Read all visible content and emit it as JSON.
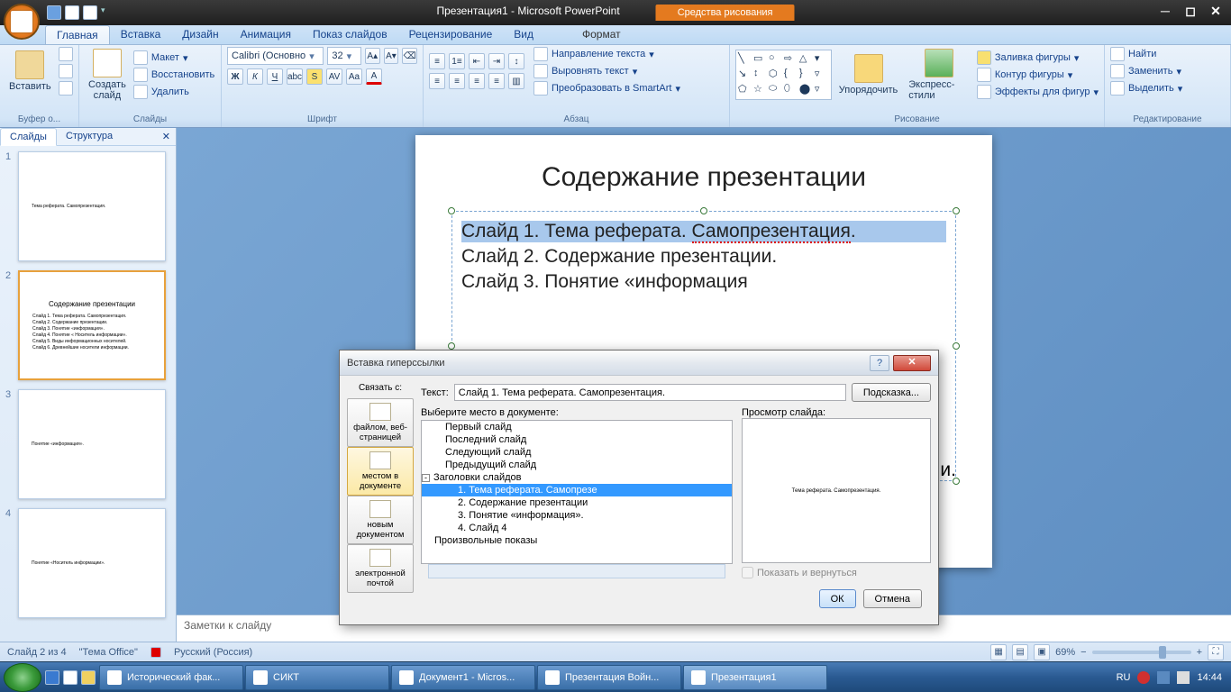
{
  "titlebar": {
    "doc_title": "Презентация1 - Microsoft PowerPoint",
    "context_tab": "Средства рисования"
  },
  "win_controls": {
    "min": "─",
    "max": "◻",
    "close": "✕"
  },
  "ribbon_tabs": [
    "Главная",
    "Вставка",
    "Дизайн",
    "Анимация",
    "Показ слайдов",
    "Рецензирование",
    "Вид"
  ],
  "ribbon_ctx_tab": "Формат",
  "ribbon": {
    "clipboard": {
      "paste": "Вставить",
      "group": "Буфер о..."
    },
    "slides": {
      "new": "Создать\nслайд",
      "layout": "Макет",
      "reset": "Восстановить",
      "delete": "Удалить",
      "group": "Слайды"
    },
    "font": {
      "name": "Calibri (Основно",
      "size": "32",
      "group": "Шрифт"
    },
    "para": {
      "dir": "Направление текста",
      "align": "Выровнять текст",
      "smart": "Преобразовать в SmartArt",
      "group": "Абзац"
    },
    "draw": {
      "arrange": "Упорядочить",
      "quick": "Экспресс-стили",
      "fill": "Заливка фигуры",
      "outline": "Контур фигуры",
      "effects": "Эффекты для фигур",
      "group": "Рисование"
    },
    "edit": {
      "find": "Найти",
      "replace": "Заменить",
      "select": "Выделить",
      "group": "Редактирование"
    }
  },
  "side_panel": {
    "tabs": {
      "slides": "Слайды",
      "outline": "Структура"
    },
    "thumbs": [
      {
        "n": "1",
        "title": "",
        "lines": [
          "Тема реферата. Самопрезентация."
        ]
      },
      {
        "n": "2",
        "title": "Содержание презентации",
        "lines": [
          "Слайд 1. Тема реферата. Самопрезентация.",
          "Слайд 2. Содержание презентации.",
          "Слайд 3. Понятие «информация».",
          "Слайд 4. Понятие « Носитель информации».",
          "Слайд 5. Виды информационных носителей.",
          "Слайд 6. Древнейшие носители информации."
        ],
        "selected": true
      },
      {
        "n": "3",
        "title": "",
        "lines": [
          "Понятие «информация»."
        ]
      },
      {
        "n": "4",
        "title": "",
        "lines": [
          "Понятие «Носитель информации»."
        ]
      }
    ]
  },
  "slide": {
    "title": "Содержание презентации",
    "lines": [
      {
        "text_a": "Слайд 1. Тема реферата. ",
        "text_b": "Самопрезентация",
        ".": ".",
        "sel": true,
        "err": true
      },
      {
        "text_a": "Слайд 2. Содержание презентации.",
        "sel": false
      },
      {
        "text_a": "Слайд 3. Понятие «информация».",
        "sel": false,
        "partial": true
      }
    ],
    "hidden_tail": "и."
  },
  "notes_placeholder": "Заметки к слайду",
  "dialog": {
    "title": "Вставка гиперссылки",
    "link_with": "Связать с:",
    "text_label": "Текст:",
    "text_value": "Слайд 1. Тема реферата. Самопрезентация.",
    "hint_btn": "Подсказка...",
    "link_targets": [
      {
        "label": "файлом, веб-\nстраницей"
      },
      {
        "label": "местом в\nдокументе",
        "sel": true
      },
      {
        "label": "новым\nдокументом"
      },
      {
        "label": "электронной\nпочтой"
      }
    ],
    "tree_label": "Выберите место в документе:",
    "tree": [
      {
        "t": "Первый слайд",
        "lvl": 1
      },
      {
        "t": "Последний слайд",
        "lvl": 1
      },
      {
        "t": "Следующий слайд",
        "lvl": 1
      },
      {
        "t": "Предыдущий слайд",
        "lvl": 1
      },
      {
        "t": "Заголовки слайдов",
        "lvl": 0,
        "exp": "-"
      },
      {
        "t": "1. Тема реферата. Самопрезе",
        "lvl": 2,
        "sel": true
      },
      {
        "t": "2. Содержание презентации",
        "lvl": 2
      },
      {
        "t": "3. Понятие «информация».",
        "lvl": 2
      },
      {
        "t": "4. Слайд 4",
        "lvl": 2
      },
      {
        "t": "Произвольные показы",
        "lvl": 0
      }
    ],
    "preview_label": "Просмотр слайда:",
    "preview_text": "Тема реферата. Самопрезентация.",
    "show_return": "Показать и вернуться",
    "ok": "ОК",
    "cancel": "Отмена"
  },
  "status": {
    "slide_pos": "Слайд 2 из 4",
    "theme": "\"Тема Office\"",
    "lang": "Русский (Россия)",
    "zoom": "69%"
  },
  "taskbar": {
    "items": [
      {
        "label": "Исторический фак..."
      },
      {
        "label": "СИКТ"
      },
      {
        "label": "Документ1 - Micros..."
      },
      {
        "label": "Презентация Войн..."
      },
      {
        "label": "Презентация1",
        "active": true
      }
    ],
    "lang": "RU",
    "time": "14:44"
  }
}
